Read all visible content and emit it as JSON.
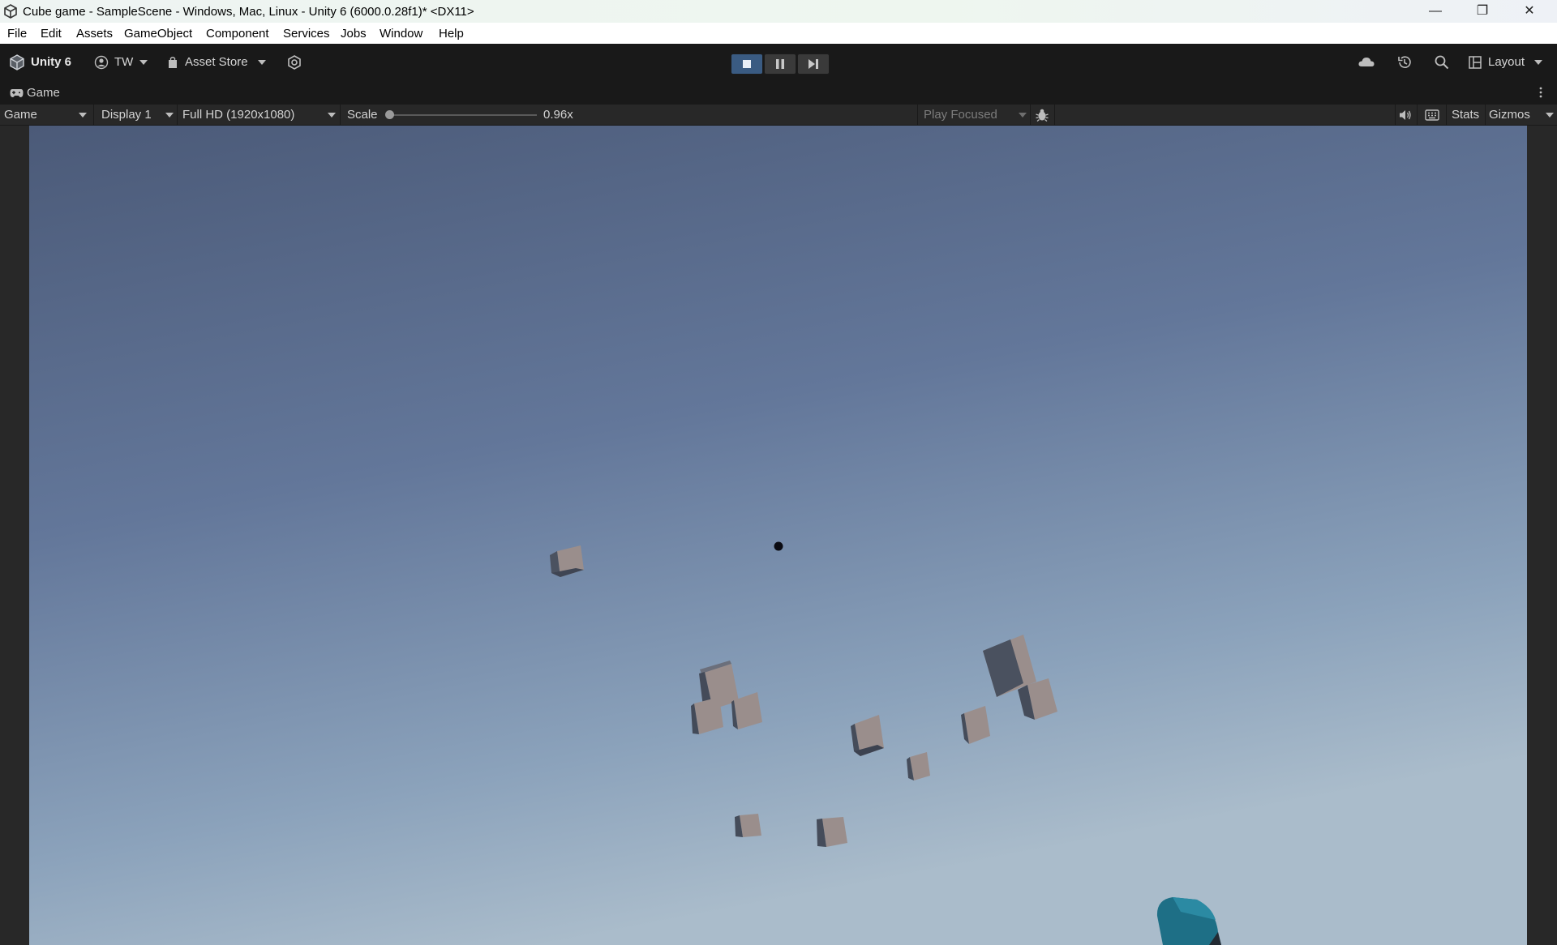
{
  "window": {
    "title": "Cube game - SampleScene - Windows, Mac, Linux - Unity 6 (6000.0.28f1)* <DX11>",
    "minimize_glyph": "—",
    "maximize_glyph": "❐",
    "close_glyph": "✕"
  },
  "menu": [
    "File",
    "Edit",
    "Assets",
    "GameObject",
    "Component",
    "Services",
    "Jobs",
    "Window",
    "Help"
  ],
  "toolbar": {
    "brand_label": "Unity 6",
    "account_label": "TW",
    "asset_store_label": "Asset Store",
    "layout_label": "Layout",
    "play_state": "playing"
  },
  "game_tab": {
    "label": "Game"
  },
  "game_toolbar": {
    "view_mode": "Game",
    "display": "Display 1",
    "resolution": "Full HD (1920x1080)",
    "scale_label": "Scale",
    "scale_value": "0.96x",
    "play_focus": "Play Focused",
    "stats_label": "Stats",
    "gizmos_label": "Gizmos"
  },
  "scene": {
    "sky_top_color": "#4e5d7c",
    "sky_bottom_color": "#a9bcc9",
    "cube_light_color": "#9a8e8c",
    "cube_dark_color": "#454c5a",
    "player_color": "#1e6f86",
    "crosshair_color": "#0b0b12"
  }
}
